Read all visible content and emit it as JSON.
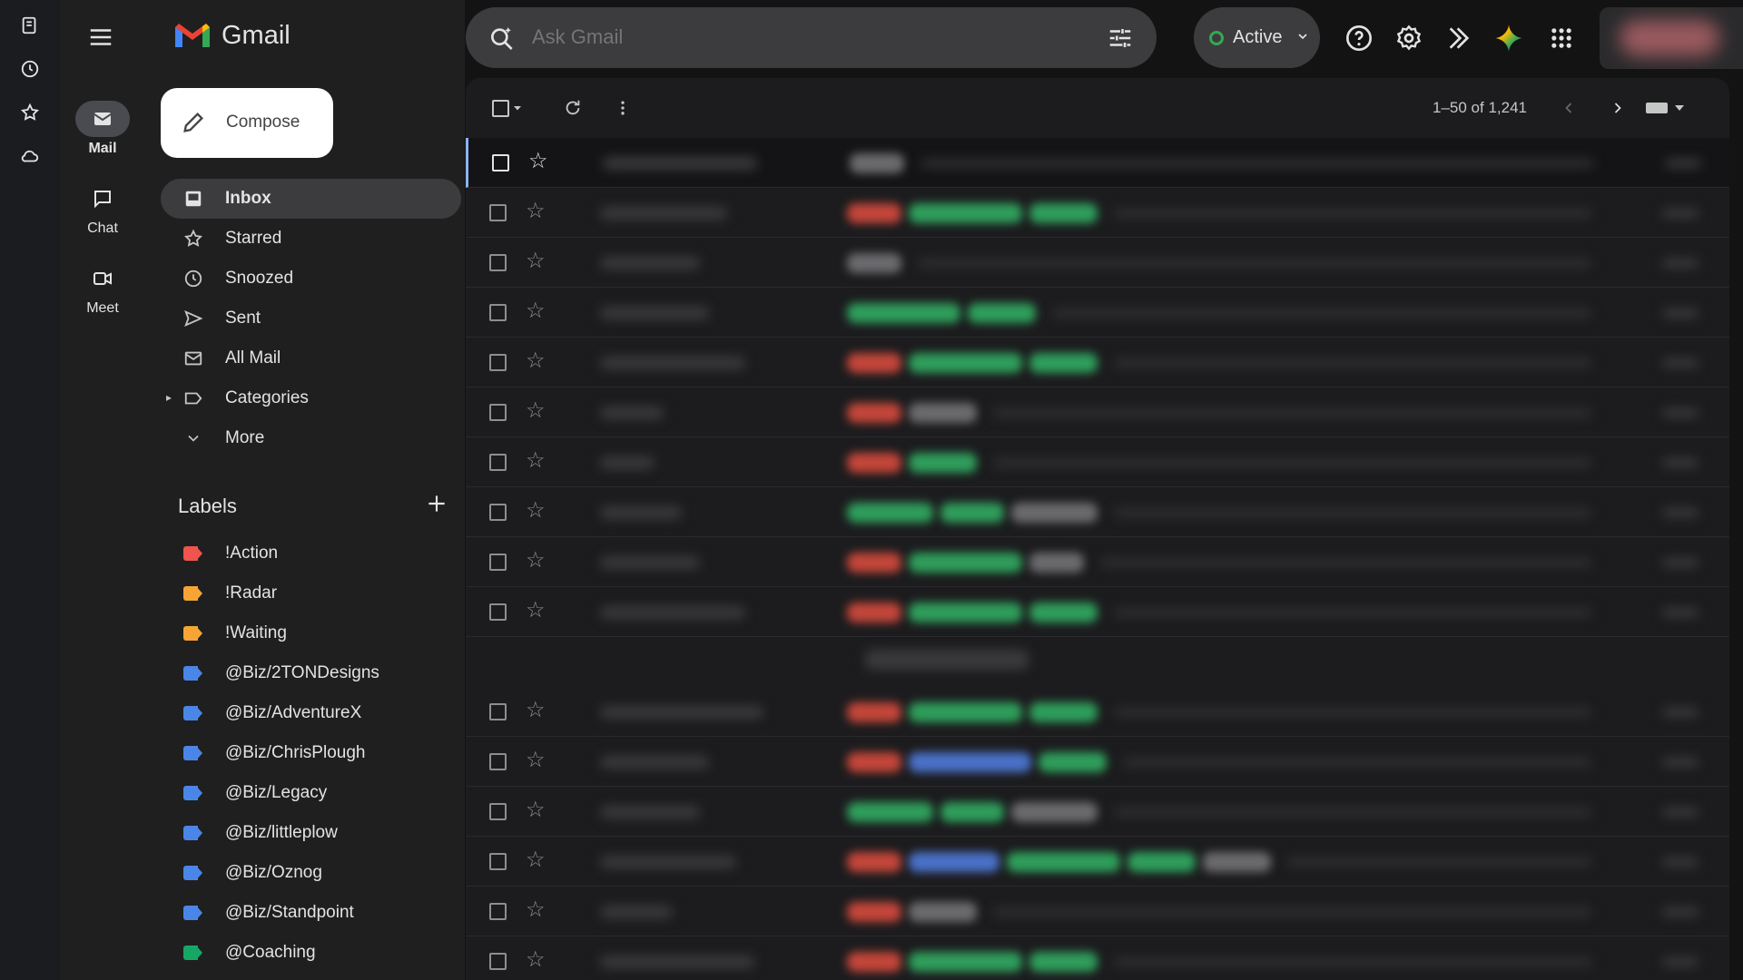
{
  "app": {
    "title": "Gmail"
  },
  "rail": {
    "items": [
      {
        "label": "Mail",
        "icon": "mail-icon"
      },
      {
        "label": "Chat",
        "icon": "chat-icon"
      },
      {
        "label": "Meet",
        "icon": "video-icon"
      }
    ]
  },
  "compose": {
    "label": "Compose"
  },
  "nav": {
    "items": [
      {
        "label": "Inbox",
        "icon": "inbox-icon",
        "active": true
      },
      {
        "label": "Starred",
        "icon": "star-icon"
      },
      {
        "label": "Snoozed",
        "icon": "clock-icon"
      },
      {
        "label": "Sent",
        "icon": "send-icon"
      },
      {
        "label": "All Mail",
        "icon": "all-mail-icon"
      },
      {
        "label": "Categories",
        "icon": "label-outline-icon"
      },
      {
        "label": "More",
        "icon": "chevron-down-icon"
      }
    ]
  },
  "labels": {
    "heading": "Labels",
    "items": [
      {
        "label": "!Action",
        "color": "#f0544f"
      },
      {
        "label": "!Radar",
        "color": "#f6a534"
      },
      {
        "label": "!Waiting",
        "color": "#f6a534"
      },
      {
        "label": "@Biz/2TONDesigns",
        "color": "#4a86e8"
      },
      {
        "label": "@Biz/AdventureX",
        "color": "#4a86e8"
      },
      {
        "label": "@Biz/ChrisPlough",
        "color": "#4a86e8"
      },
      {
        "label": "@Biz/Legacy",
        "color": "#4a86e8"
      },
      {
        "label": "@Biz/littleplow",
        "color": "#4a86e8"
      },
      {
        "label": "@Biz/Oznog",
        "color": "#4a86e8"
      },
      {
        "label": "@Biz/Standpoint",
        "color": "#4a86e8"
      },
      {
        "label": "@Coaching",
        "color": "#16a765"
      }
    ]
  },
  "search": {
    "placeholder": "Ask Gmail"
  },
  "status": {
    "label": "Active",
    "color": "#34a853"
  },
  "toolbar": {
    "pagination": "1–50 of 1,241"
  },
  "colors": {
    "chip_red": "#c4463a",
    "chip_green": "#2f9e5b",
    "chip_blue": "#4a72c9",
    "chip_gray": "#6b6b6e"
  }
}
